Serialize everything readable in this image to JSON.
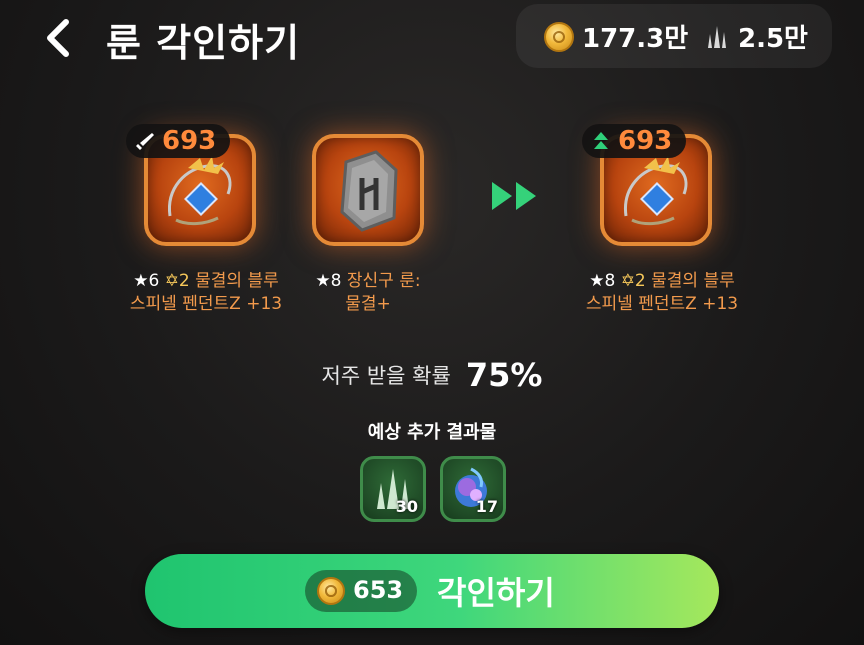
{
  "header": {
    "title": "룬 각인하기",
    "gold": "177.3만",
    "crystal": "2.5만"
  },
  "source_item": {
    "power": "693",
    "label_stars": "★6",
    "label_grade": "✡2",
    "label_name_line1": "물결의 블루",
    "label_name_line2": "스피넬 펜던트Z +13",
    "icon": "pendant-icon",
    "badge_icon": "sword-icon"
  },
  "rune": {
    "label_stars": "★8",
    "label_line1": "장신구 룬:",
    "label_line2": "물결+",
    "icon": "rune-stone-icon"
  },
  "result_item": {
    "power": "693",
    "label_stars": "★8",
    "label_grade": "✡2",
    "label_name_line1": "물결의 블루",
    "label_name_line2": "스피넬 펜던트Z +13",
    "icon": "pendant-icon",
    "badge_icon": "power-up-icon"
  },
  "curse": {
    "label": "저주 받을 확률",
    "value": "75%"
  },
  "extra_results": {
    "title": "예상 추가 결과물",
    "items": [
      {
        "icon": "crystal-shard-icon",
        "count": "30"
      },
      {
        "icon": "essence-orb-icon",
        "count": "17"
      }
    ]
  },
  "engrave_button": {
    "cost": "653",
    "label": "각인하기"
  },
  "colors": {
    "accent_orange": "#ff8a3c",
    "button_green": "#1fc46f",
    "button_lime": "#a6e85c"
  }
}
